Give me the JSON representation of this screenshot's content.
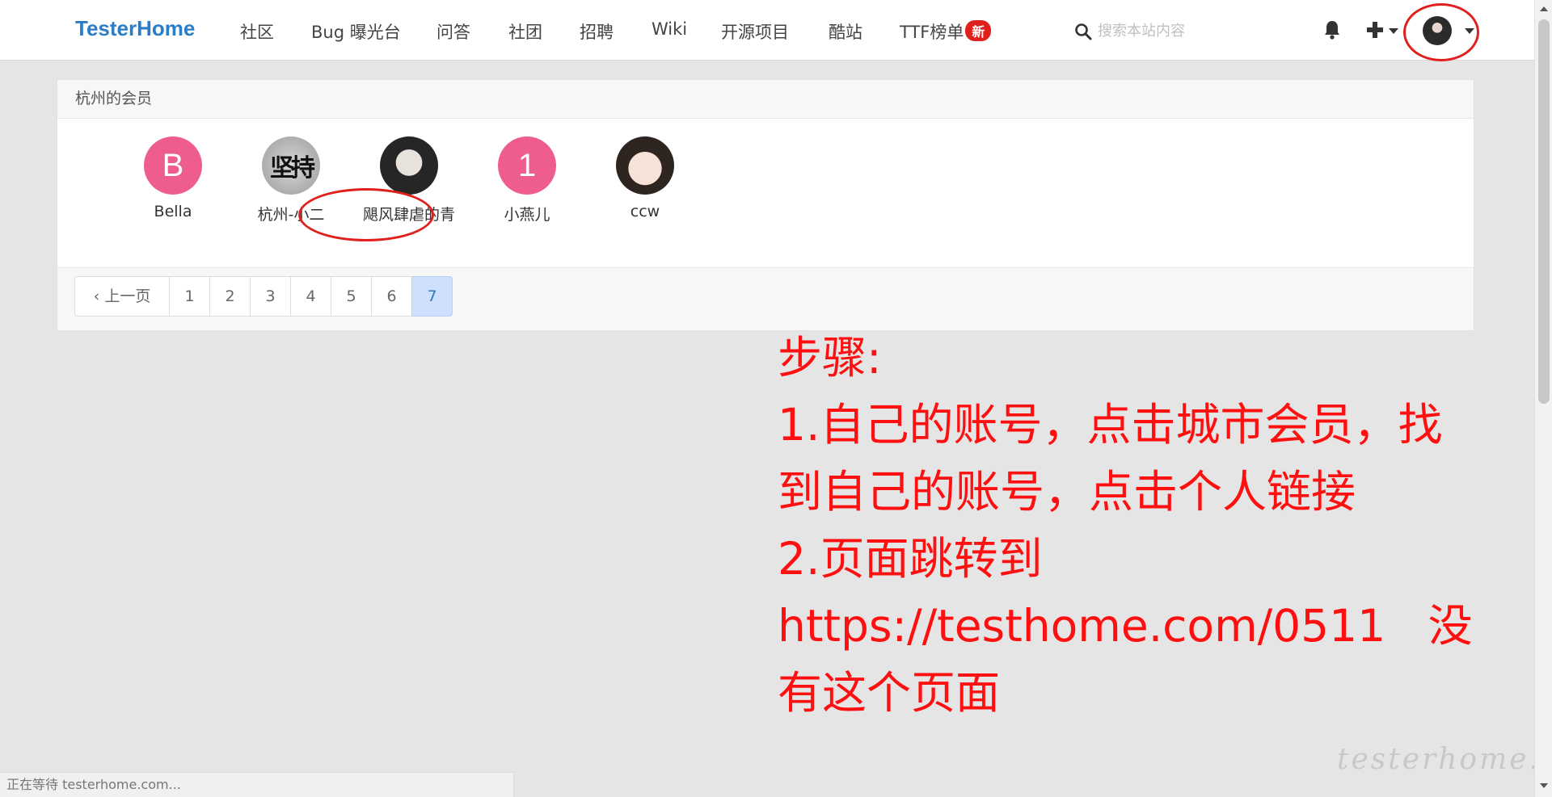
{
  "navbar": {
    "brand": "TesterHome",
    "items": [
      {
        "label": "社区"
      },
      {
        "label": "Bug 曝光台"
      },
      {
        "label": "问答"
      },
      {
        "label": "社团"
      },
      {
        "label": "招聘"
      },
      {
        "label": "Wiki"
      },
      {
        "label": "开源项目"
      },
      {
        "label": "酷站"
      },
      {
        "label": "TTF榜单"
      }
    ],
    "new_badge": "新",
    "search_placeholder": "搜索本站内容",
    "icons": {
      "search": "search-icon",
      "notifications": "bell-icon",
      "create": "plus-icon",
      "user": "user-avatar"
    }
  },
  "panel": {
    "title": "杭州的会员",
    "members": [
      {
        "name": "Bella",
        "avatar_text": "B",
        "avatar": "letter"
      },
      {
        "name": "杭州-小二",
        "avatar_text": "坚持",
        "avatar": "calligraphy"
      },
      {
        "name": "飓风肆虐的青",
        "avatar_text": "",
        "avatar": "photo"
      },
      {
        "name": "小燕儿",
        "avatar_text": "1",
        "avatar": "letter"
      },
      {
        "name": "ccw",
        "avatar_text": "",
        "avatar": "photo"
      }
    ]
  },
  "pagination": {
    "prev_label": "上一页",
    "pages": [
      "1",
      "2",
      "3",
      "4",
      "5",
      "6",
      "7"
    ],
    "active_page": "7"
  },
  "annotation": {
    "lines": [
      "步骤:",
      "1.自己的账号，点击城市会员，找",
      "到自己的账号，点击个人链接",
      "2.页面跳转到",
      "https://testhome.com/0511   没",
      "有这个页面"
    ],
    "color": "#ff1010"
  },
  "status_bar": {
    "text": "正在等待 testerhome.com..."
  },
  "watermark": {
    "text": "testerhome.com"
  },
  "colors": {
    "brand": "#2a7dc9",
    "badge": "#e0201c",
    "avatar_pink": "#ee5d8c",
    "active_page_bg": "#cfe0ff"
  }
}
